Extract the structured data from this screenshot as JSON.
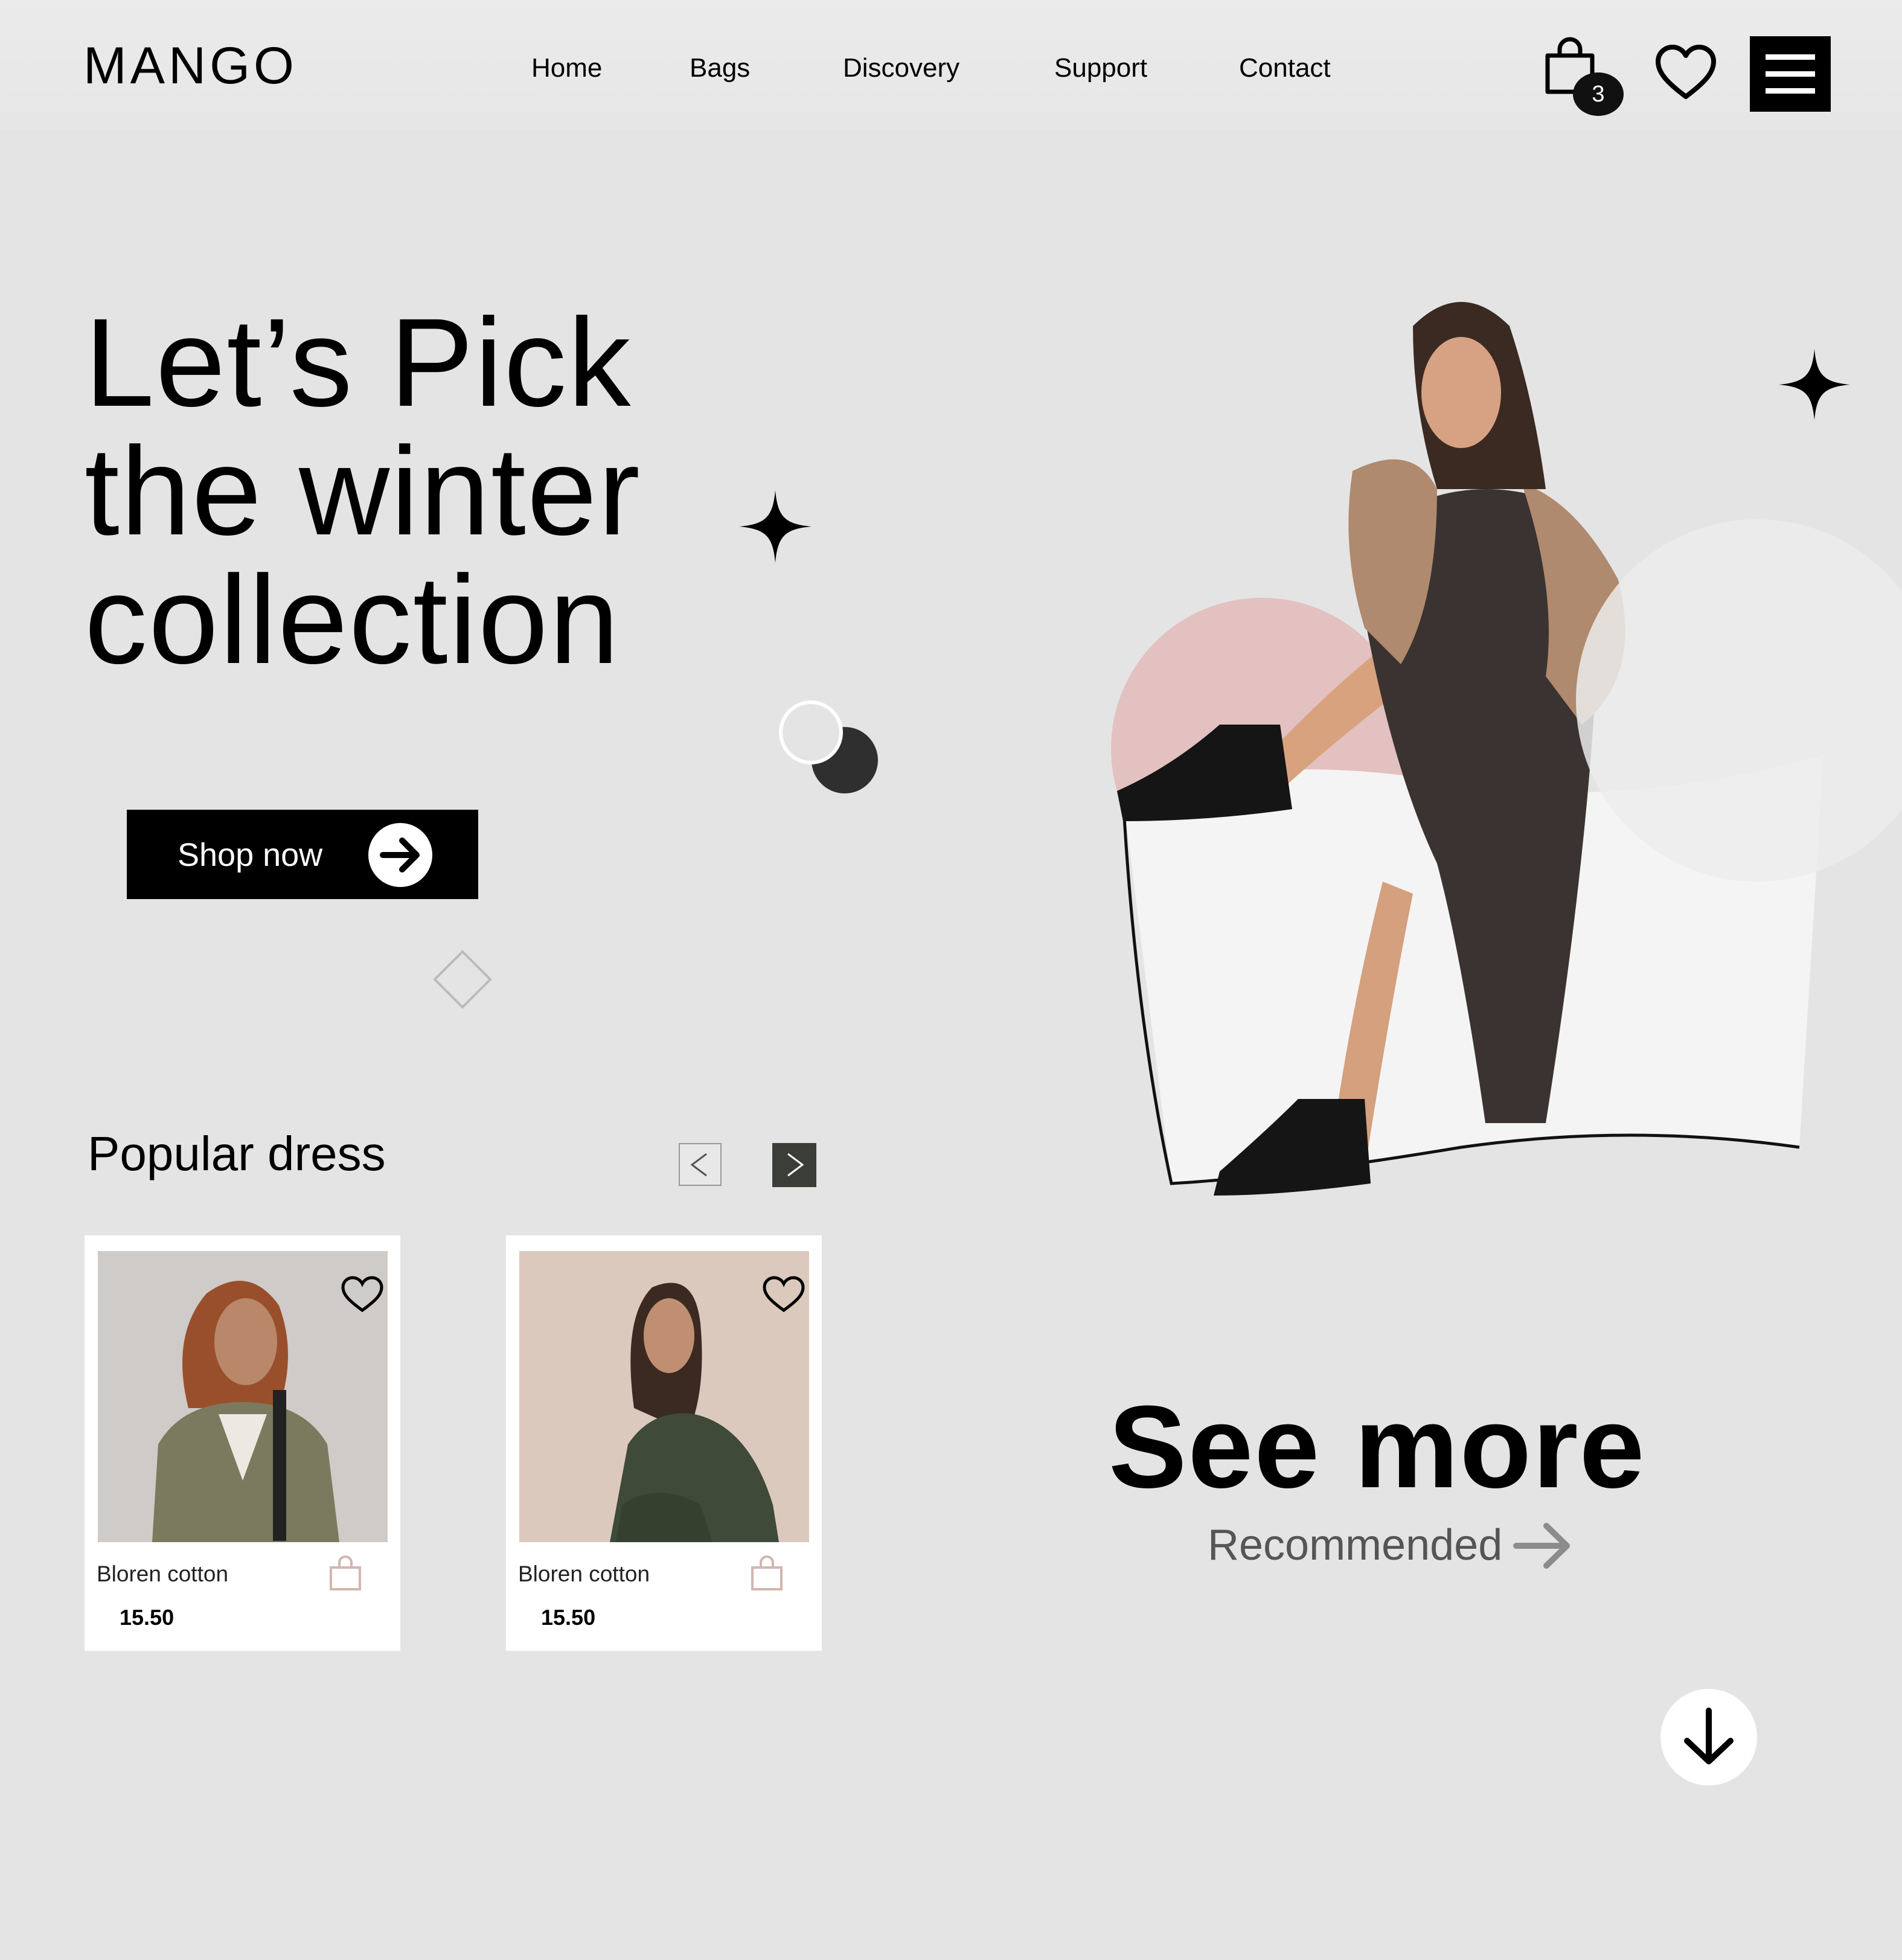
{
  "brand": {
    "logo": "MANGO"
  },
  "nav": {
    "items": [
      {
        "label": "Home"
      },
      {
        "label": "Bags"
      },
      {
        "label": "Discovery"
      },
      {
        "label": "Support"
      },
      {
        "label": "Contact"
      }
    ]
  },
  "header": {
    "cart_count": "3",
    "icons": [
      "bag-icon",
      "heart-icon",
      "hamburger-menu-icon"
    ]
  },
  "hero": {
    "title_lines": [
      "Let’s Pick",
      "the winter",
      "collection"
    ],
    "cta_label": "Shop now"
  },
  "popular": {
    "title": "Popular dress",
    "products": [
      {
        "name": "Bloren cotton",
        "price": "15.50"
      },
      {
        "name": "Bloren cotton",
        "price": "15.50"
      }
    ]
  },
  "see_more": {
    "title": "See more",
    "link_label": "Recommended"
  },
  "colors": {
    "background": "#e4e4e4",
    "accent": "#000000",
    "pink_circle": "#e3c1c0",
    "dark_button": "#3b3d39"
  }
}
